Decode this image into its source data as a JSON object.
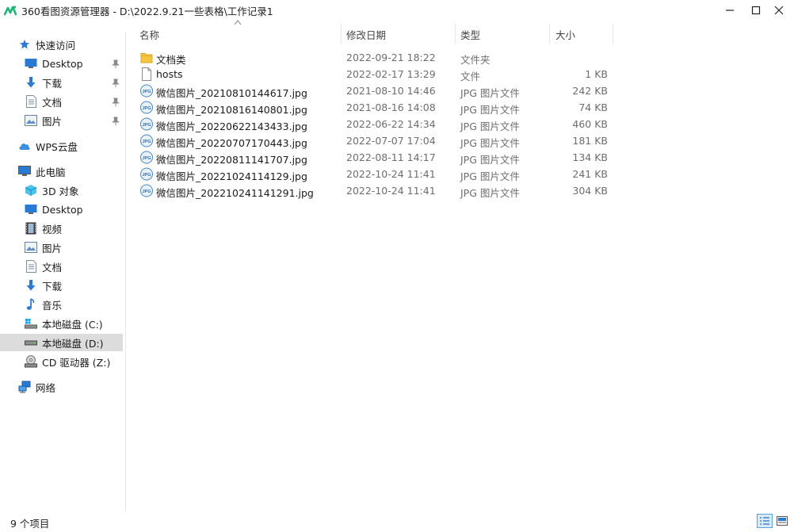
{
  "window": {
    "title": "360看图资源管理器 - D:\\2022.9.21一些表格\\工作记录1"
  },
  "nav": {
    "quick_access": "快速访问",
    "quick_items": [
      {
        "label": "Desktop",
        "icon": "desktop-icon"
      },
      {
        "label": "下载",
        "icon": "download-icon"
      },
      {
        "label": "文档",
        "icon": "document-icon"
      },
      {
        "label": "图片",
        "icon": "picture-icon"
      }
    ],
    "wps": "WPS云盘",
    "this_pc": "此电脑",
    "pc_items": [
      {
        "label": "3D 对象",
        "icon": "3d-object-icon"
      },
      {
        "label": "Desktop",
        "icon": "desktop-icon"
      },
      {
        "label": "视频",
        "icon": "video-icon"
      },
      {
        "label": "图片",
        "icon": "picture-icon"
      },
      {
        "label": "文档",
        "icon": "document-icon"
      },
      {
        "label": "下载",
        "icon": "download-icon"
      },
      {
        "label": "音乐",
        "icon": "music-icon"
      },
      {
        "label": "本地磁盘 (C:)",
        "icon": "drive-c-icon"
      },
      {
        "label": "本地磁盘 (D:)",
        "icon": "drive-icon",
        "selected": true
      },
      {
        "label": "CD 驱动器 (Z:)",
        "icon": "cd-drive-icon"
      }
    ],
    "network": "网络"
  },
  "columns": {
    "name": "名称",
    "date": "修改日期",
    "type": "类型",
    "size": "大小"
  },
  "files": [
    {
      "name": "文档类",
      "date": "2022-09-21 18:22",
      "type": "文件夹",
      "size": "",
      "kind": "folder"
    },
    {
      "name": "hosts",
      "date": "2022-02-17 13:29",
      "type": "文件",
      "size": "1 KB",
      "kind": "file"
    },
    {
      "name": "微信图片_20210810144617.jpg",
      "date": "2021-08-10 14:46",
      "type": "JPG 图片文件",
      "size": "242 KB",
      "kind": "jpg"
    },
    {
      "name": "微信图片_20210816140801.jpg",
      "date": "2021-08-16 14:08",
      "type": "JPG 图片文件",
      "size": "74 KB",
      "kind": "jpg"
    },
    {
      "name": "微信图片_20220622143433.jpg",
      "date": "2022-06-22 14:34",
      "type": "JPG 图片文件",
      "size": "460 KB",
      "kind": "jpg"
    },
    {
      "name": "微信图片_20220707170443.jpg",
      "date": "2022-07-07 17:04",
      "type": "JPG 图片文件",
      "size": "181 KB",
      "kind": "jpg"
    },
    {
      "name": "微信图片_20220811141707.jpg",
      "date": "2022-08-11 14:17",
      "type": "JPG 图片文件",
      "size": "134 KB",
      "kind": "jpg"
    },
    {
      "name": "微信图片_20221024114129.jpg",
      "date": "2022-10-24 11:41",
      "type": "JPG 图片文件",
      "size": "241 KB",
      "kind": "jpg"
    },
    {
      "name": "微信图片_202210241141291.jpg",
      "date": "2022-10-24 11:41",
      "type": "JPG 图片文件",
      "size": "304 KB",
      "kind": "jpg"
    }
  ],
  "status": {
    "count": "9 个项目"
  },
  "jpg_badge": "JPG"
}
